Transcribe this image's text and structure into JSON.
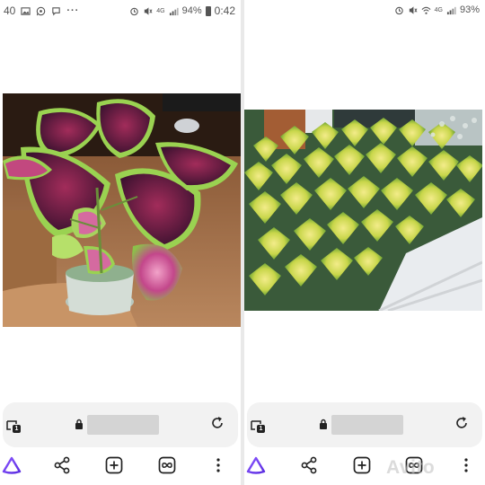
{
  "left_panel": {
    "status": {
      "time": "40",
      "battery": "94%",
      "time2": "0:42",
      "network": "4G"
    },
    "address_bar": {
      "tab_count": "1"
    }
  },
  "right_panel": {
    "status": {
      "battery": "93%",
      "network": "4G"
    },
    "address_bar": {
      "tab_count": "1"
    },
    "watermark": "Avito"
  },
  "icons": {
    "status_left": [
      "image-icon",
      "whatsapp-icon",
      "viber-icon",
      "more-dots-icon"
    ],
    "status_right": [
      "alarm-icon",
      "mute-icon",
      "wifi-icon",
      "signal-icon",
      "battery-icon"
    ],
    "nav": [
      "alice-assistant-icon",
      "share-icon",
      "new-tab-icon",
      "tabs-overview-icon",
      "menu-icon"
    ]
  },
  "colors": {
    "accent_purple": "#7b3ff2",
    "address_bar_bg": "#f2f2f2",
    "url_mask": "#d4d4d4"
  }
}
